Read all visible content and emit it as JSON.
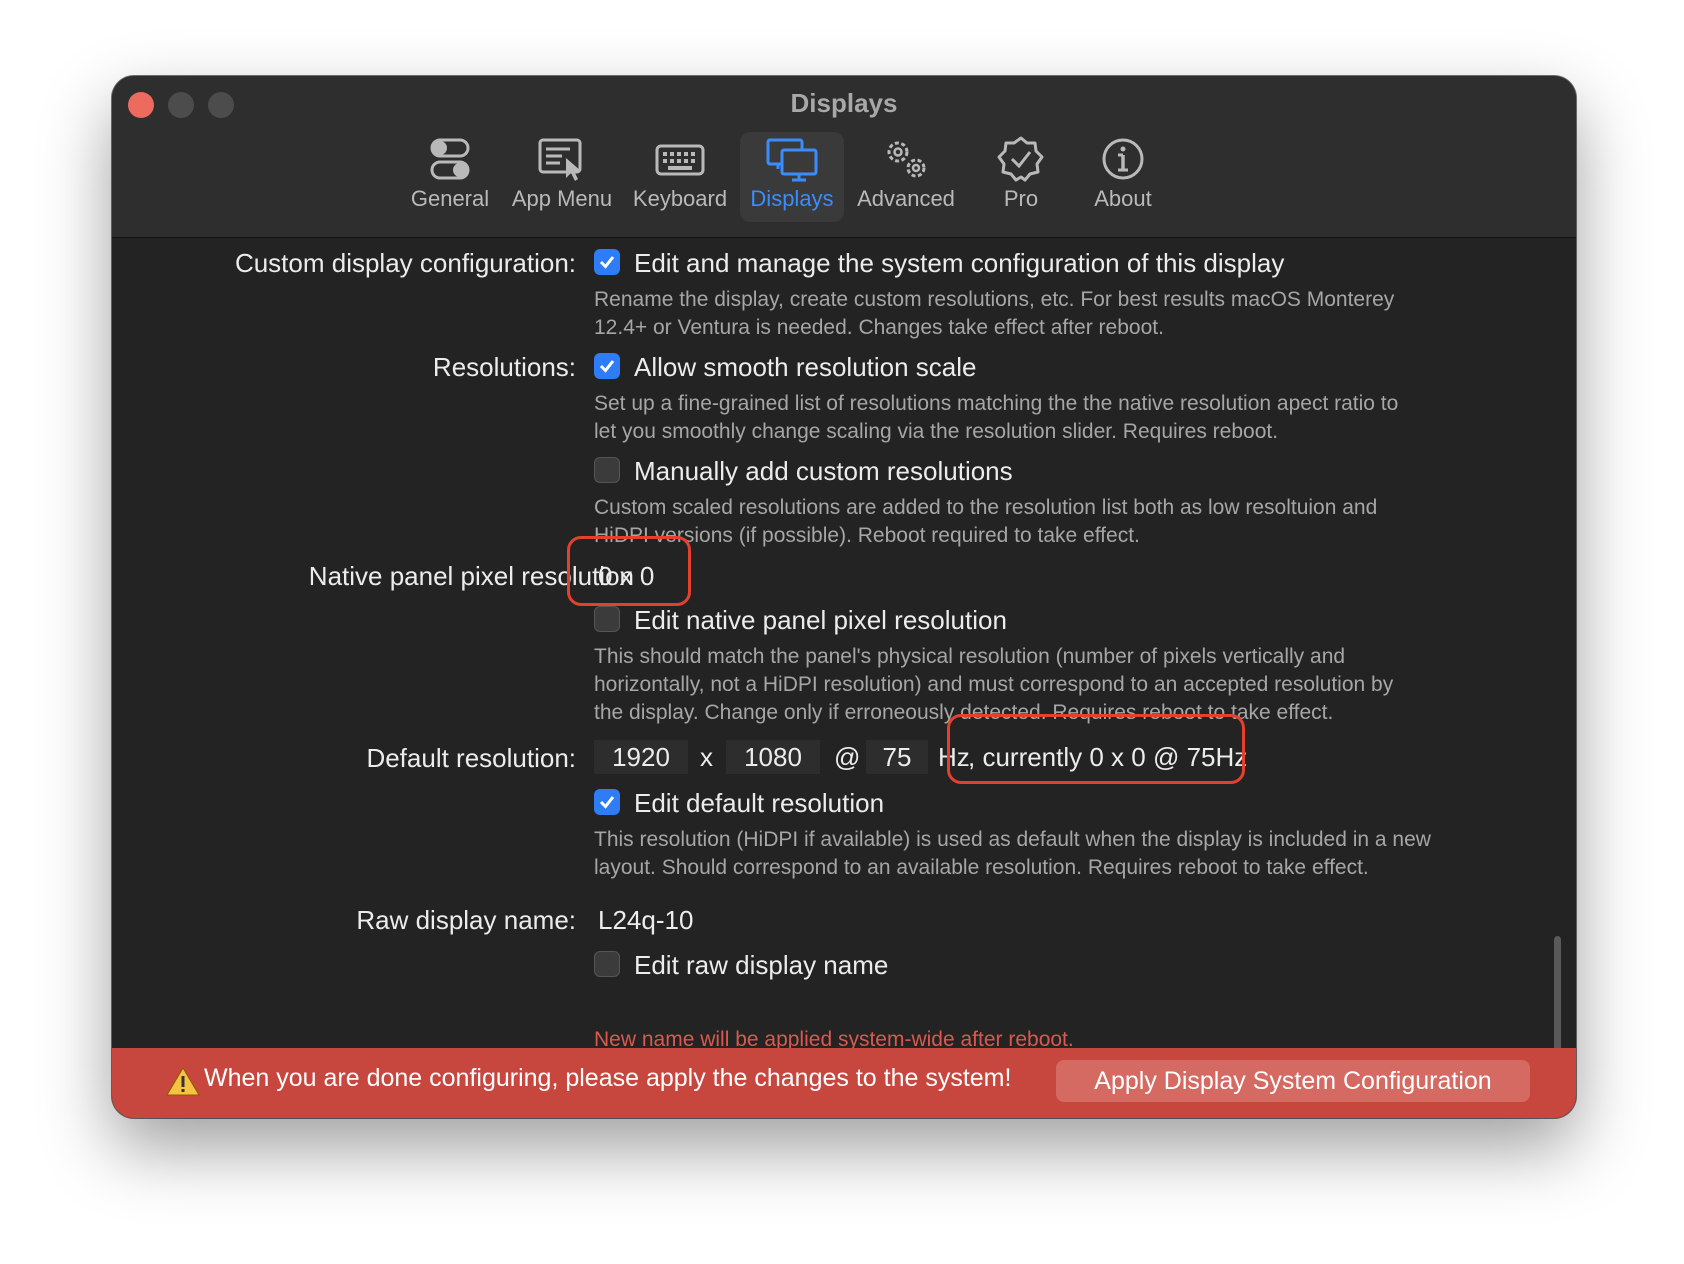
{
  "window": {
    "title": "Displays"
  },
  "tabs": [
    {
      "label": "General",
      "icon": "toggle-switches-icon"
    },
    {
      "label": "App Menu",
      "icon": "app-menu-pointer-icon"
    },
    {
      "label": "Keyboard",
      "icon": "keyboard-icon"
    },
    {
      "label": "Displays",
      "icon": "displays-icon",
      "active": true
    },
    {
      "label": "Advanced",
      "icon": "gears-icon"
    },
    {
      "label": "Pro",
      "icon": "verified-badge-icon"
    },
    {
      "label": "About",
      "icon": "info-icon"
    }
  ],
  "settings": {
    "custom_config": {
      "label": "Custom display configuration:",
      "option": "Edit and manage the system configuration of this display",
      "checked": true,
      "desc_line1": "Rename the display, create custom resolutions, etc. For best results macOS Monterey",
      "desc_line2": "12.4+ or Ventura is needed. Changes take effect after reboot."
    },
    "resolutions": {
      "label": "Resolutions:",
      "smooth_option": "Allow smooth resolution scale",
      "smooth_checked": true,
      "smooth_desc_line1": "Set up a fine-grained list of resolutions matching the the native resolution apect ratio to",
      "smooth_desc_line2": "let you smoothly change scaling via the resolution slider. Requires reboot.",
      "manual_option": "Manually add custom resolutions",
      "manual_checked": false,
      "manual_desc_line1": "Custom scaled resolutions are added to the resolution list both as low resoltuion and",
      "manual_desc_line2": "HiDPI versions (if possible). Reboot required to take effect."
    },
    "native": {
      "label": "Native panel pixel resolution",
      "value": "0 x 0",
      "option": "Edit native panel pixel resolution",
      "checked": false,
      "desc_line1": "This should match the panel's physical resolution (number of pixels vertically and",
      "desc_line2": "horizontally, not a HiDPI resolution) and must correspond to an accepted resolution by",
      "desc_line3": "the display. Change only if erroneously detected. Requires reboot to take effect."
    },
    "default_res": {
      "label": "Default resolution:",
      "width": "1920",
      "x_sep": "x",
      "height": "1080",
      "at_sep": "@",
      "refresh": "75",
      "hz": "Hz",
      "current": ", currently 0 x 0 @ 75Hz",
      "option": "Edit default resolution",
      "checked": true,
      "desc_line1": "This resolution (HiDPI if available) is used as default when the display is included in a new",
      "desc_line2": "layout. Should correspond to an available resolution. Requires reboot to take effect."
    },
    "raw_name": {
      "label": "Raw display name:",
      "value": "L24q-10",
      "option": "Edit raw display name",
      "checked": false,
      "desc": "New name will be applied system-wide after reboot."
    }
  },
  "banner": {
    "message": "When you are done configuring, please apply the changes to the system!",
    "button": "Apply Display System Configuration",
    "color": "#c7473e"
  },
  "colors": {
    "accent": "#3a8dff",
    "checkbox_on": "#2f7df6",
    "highlight": "#e4402e"
  }
}
